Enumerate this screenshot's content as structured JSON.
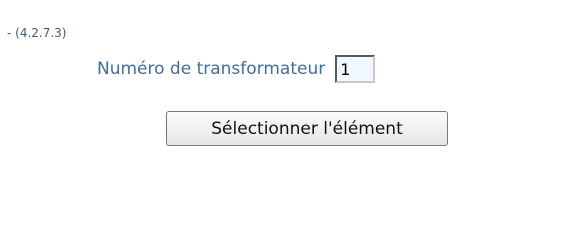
{
  "header": {
    "version_text": "- (4.2.7.3)"
  },
  "form": {
    "transformer_label": "Numéro de transformateur",
    "transformer_value": "1",
    "select_button_label": "Sélectionner l'élément"
  },
  "colors": {
    "label": "#3e6fa1",
    "version": "#3b5b86",
    "input_bg": "#f0f7ff"
  }
}
